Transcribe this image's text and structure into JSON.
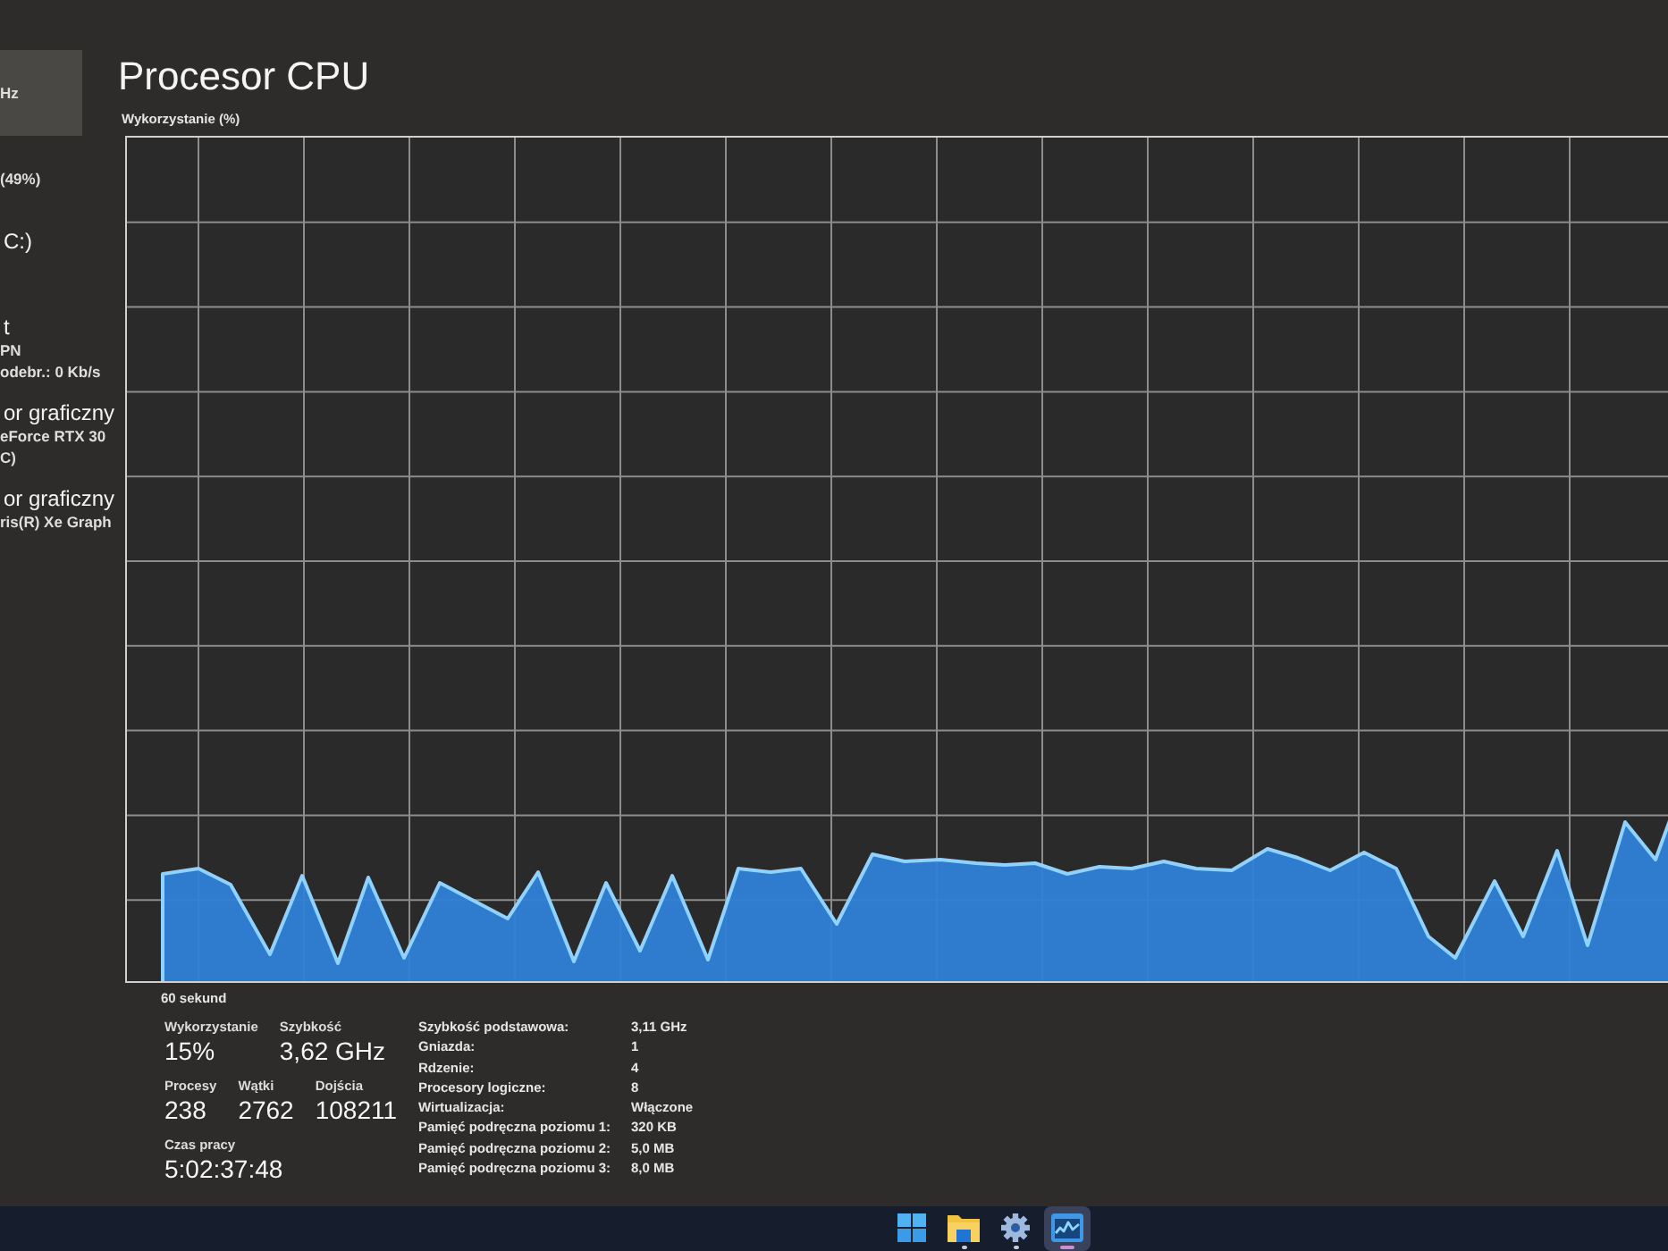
{
  "sidebar": {
    "items": [
      {
        "selected": true,
        "lines": [
          {
            "kind": "detail",
            "text": "Hz"
          }
        ]
      },
      {
        "selected": false,
        "lines": [
          {
            "kind": "detail",
            "text": "(49%)"
          }
        ]
      },
      {
        "selected": false,
        "lines": [
          {
            "kind": "title",
            "text": "C:)"
          }
        ]
      },
      {
        "selected": false,
        "lines": [
          {
            "kind": "title",
            "text": "t"
          },
          {
            "kind": "detail",
            "text": "PN"
          },
          {
            "kind": "detail",
            "text": "odebr.: 0 Kb/s"
          }
        ]
      },
      {
        "selected": false,
        "lines": [
          {
            "kind": "title",
            "text": "or graficzny"
          },
          {
            "kind": "detail",
            "text": "eForce RTX 30"
          },
          {
            "kind": "detail",
            "text": "C)"
          }
        ]
      },
      {
        "selected": false,
        "lines": [
          {
            "kind": "title",
            "text": "or graficzny"
          },
          {
            "kind": "detail",
            "text": "ris(R) Xe Graph"
          }
        ]
      }
    ]
  },
  "page": {
    "title": "Procesor CPU"
  },
  "graph": {
    "label": "Wykorzystanie (%)",
    "time_span": "60 sekund"
  },
  "stat_rows": [
    [
      {
        "label": "Wykorzystanie",
        "value": "15%"
      },
      {
        "label": "Szybkość",
        "value": "3,62 GHz"
      }
    ],
    [
      {
        "label": "Procesy",
        "value": "238"
      },
      {
        "label": "Wątki",
        "value": "2762"
      },
      {
        "label": "Dojścia",
        "value": "108211"
      }
    ],
    [
      {
        "label": "Czas pracy",
        "value": "5:02:37:48"
      }
    ]
  ],
  "specs": [
    {
      "label": "Szybkość podstawowa:",
      "value": "3,11 GHz"
    },
    {
      "label": "Gniazda:",
      "value": "1"
    },
    {
      "label": "Rdzenie:",
      "value": "4"
    },
    {
      "label": "Procesory logiczne:",
      "value": "8"
    },
    {
      "label": "Wirtualizacja:",
      "value": "Włączone"
    },
    {
      "label": "Pamięć podręczna poziomu 1:",
      "value": "320 KB"
    },
    {
      "label": "Pamięć podręczna poziomu 2:",
      "value": "5,0 MB"
    },
    {
      "label": "Pamięć podręczna poziomu 3:",
      "value": "8,0 MB"
    }
  ],
  "taskbar": {
    "items": [
      {
        "kind": "start",
        "selected": false,
        "running": false
      },
      {
        "kind": "folder",
        "selected": false,
        "running": true
      },
      {
        "kind": "settings",
        "selected": false,
        "running": true
      },
      {
        "kind": "monitor",
        "selected": true,
        "running": true
      }
    ]
  }
}
